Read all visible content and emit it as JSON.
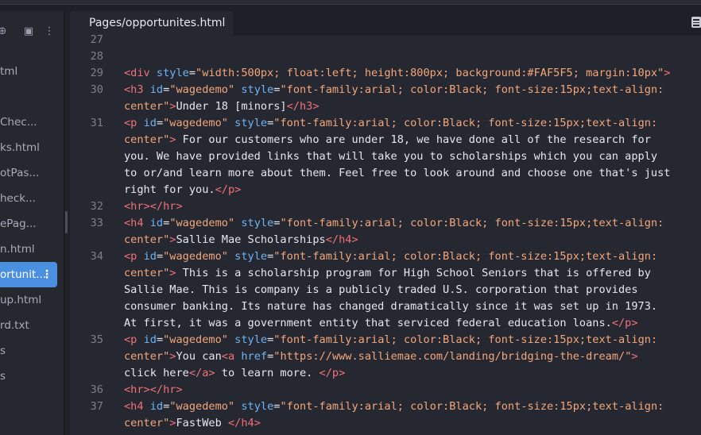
{
  "sidebar": {
    "icons": [
      "new-file-icon",
      "new-folder-icon",
      "more-icon"
    ],
    "files": [
      {
        "label": "tml",
        "active": false
      },
      {
        "label": "",
        "active": false
      },
      {
        "label": "Chec...",
        "active": false
      },
      {
        "label": "ks.html",
        "active": false
      },
      {
        "label": "otPas...",
        "active": false
      },
      {
        "label": "heck...",
        "active": false
      },
      {
        "label": "ePag...",
        "active": false
      },
      {
        "label": "n.html",
        "active": false
      },
      {
        "label": "ortunit...",
        "active": true
      },
      {
        "label": "up.html",
        "active": false
      },
      {
        "label": "rd.txt",
        "active": false
      },
      {
        "label": "s",
        "active": false
      },
      {
        "label": "s",
        "active": false
      }
    ]
  },
  "editor": {
    "tab_title": "Pages/opportunites.html",
    "lines": [
      {
        "n": "27",
        "segs": []
      },
      {
        "n": "28",
        "segs": []
      },
      {
        "n": "29",
        "segs": [
          [
            "tag",
            "<div "
          ],
          [
            "att",
            "style"
          ],
          [
            "plain",
            "="
          ],
          [
            "str",
            "\"width:500px; float:left; height:800px; background:#FAF5F5; margin:10px\""
          ],
          [
            "tag",
            ">"
          ]
        ]
      },
      {
        "n": "30",
        "segs": [
          [
            "tag",
            "<h3 "
          ],
          [
            "att",
            "id"
          ],
          [
            "plain",
            "="
          ],
          [
            "str",
            "\"wagedemo\""
          ],
          [
            "plain",
            " "
          ],
          [
            "att",
            "style"
          ],
          [
            "plain",
            "="
          ],
          [
            "str",
            "\"font-family:arial; color:Black; font-size:15px;text-align:"
          ]
        ]
      },
      {
        "n": "",
        "segs": [
          [
            "str",
            "center\""
          ],
          [
            "tag",
            ">"
          ],
          [
            "plain",
            "Under 18 [minors]"
          ],
          [
            "tag",
            "</h3>"
          ]
        ]
      },
      {
        "n": "31",
        "segs": [
          [
            "tag",
            "<p "
          ],
          [
            "att",
            "id"
          ],
          [
            "plain",
            "="
          ],
          [
            "str",
            "\"wagedemo\""
          ],
          [
            "plain",
            " "
          ],
          [
            "att",
            "style"
          ],
          [
            "plain",
            "="
          ],
          [
            "str",
            "\"font-family:arial; color:Black; font-size:15px;text-align:"
          ]
        ]
      },
      {
        "n": "",
        "segs": [
          [
            "str",
            "center\""
          ],
          [
            "tag",
            ">"
          ],
          [
            "plain",
            " For our customers who are under 18, we have done all of the research for"
          ]
        ]
      },
      {
        "n": "",
        "segs": [
          [
            "plain",
            "you. We have provided links that will take you to scholarships which you can apply"
          ]
        ]
      },
      {
        "n": "",
        "segs": [
          [
            "plain",
            "to or/and learn more about them. Feel free to look around and choose one that's just"
          ]
        ]
      },
      {
        "n": "",
        "segs": [
          [
            "plain",
            "right for you."
          ],
          [
            "tag",
            "</p>"
          ]
        ]
      },
      {
        "n": "32",
        "segs": [
          [
            "tag",
            "<hr></hr>"
          ]
        ]
      },
      {
        "n": "33",
        "segs": [
          [
            "tag",
            "<h4 "
          ],
          [
            "att",
            "id"
          ],
          [
            "plain",
            "="
          ],
          [
            "str",
            "\"wagedemo\""
          ],
          [
            "plain",
            " "
          ],
          [
            "att",
            "style"
          ],
          [
            "plain",
            "="
          ],
          [
            "str",
            "\"font-family:arial; color:Black; font-size:15px;text-align:"
          ]
        ]
      },
      {
        "n": "",
        "segs": [
          [
            "str",
            "center\""
          ],
          [
            "tag",
            ">"
          ],
          [
            "plain",
            "Sallie Mae Scholarships"
          ],
          [
            "tag",
            "</h4>"
          ]
        ]
      },
      {
        "n": "34",
        "segs": [
          [
            "tag",
            "<p "
          ],
          [
            "att",
            "id"
          ],
          [
            "plain",
            "="
          ],
          [
            "str",
            "\"wagedemo\""
          ],
          [
            "plain",
            " "
          ],
          [
            "att",
            "style"
          ],
          [
            "plain",
            "="
          ],
          [
            "str",
            "\"font-family:arial; color:Black; font-size:15px;text-align:"
          ]
        ]
      },
      {
        "n": "",
        "segs": [
          [
            "str",
            "center\""
          ],
          [
            "tag",
            ">"
          ],
          [
            "plain",
            " This is a scholarship program for High School Seniors that is offered by"
          ]
        ]
      },
      {
        "n": "",
        "segs": [
          [
            "plain",
            "Sallie Mae. This is company is a publicly traded U.S. corporation that provides"
          ]
        ]
      },
      {
        "n": "",
        "segs": [
          [
            "plain",
            "consumer banking. Its nature has changed dramatically since it was set up in 1973."
          ]
        ]
      },
      {
        "n": "",
        "segs": [
          [
            "plain",
            "At first, it was a government entity that serviced federal education loans."
          ],
          [
            "tag",
            "</p>"
          ]
        ]
      },
      {
        "n": "35",
        "segs": [
          [
            "tag",
            "<p "
          ],
          [
            "att",
            "id"
          ],
          [
            "plain",
            "="
          ],
          [
            "str",
            "\"wagedemo\""
          ],
          [
            "plain",
            " "
          ],
          [
            "att",
            "style"
          ],
          [
            "plain",
            "="
          ],
          [
            "str",
            "\"font-family:arial; color:Black; font-size:15px;text-align:"
          ]
        ]
      },
      {
        "n": "",
        "segs": [
          [
            "str",
            "center\""
          ],
          [
            "tag",
            ">"
          ],
          [
            "plain",
            "You can"
          ],
          [
            "tag",
            "<a "
          ],
          [
            "att",
            "href"
          ],
          [
            "plain",
            "="
          ],
          [
            "str",
            "\"https://www.salliemae.com/landing/bridging-the-dream/\""
          ],
          [
            "tag",
            ">"
          ]
        ]
      },
      {
        "n": "",
        "segs": [
          [
            "plain",
            "click here"
          ],
          [
            "tag",
            "</a>"
          ],
          [
            "plain",
            " to learn more. "
          ],
          [
            "tag",
            "</p>"
          ]
        ]
      },
      {
        "n": "36",
        "segs": [
          [
            "tag",
            "<hr></hr>"
          ]
        ]
      },
      {
        "n": "37",
        "segs": [
          [
            "tag",
            "<h4 "
          ],
          [
            "att",
            "id"
          ],
          [
            "plain",
            "="
          ],
          [
            "str",
            "\"wagedemo\""
          ],
          [
            "plain",
            " "
          ],
          [
            "att",
            "style"
          ],
          [
            "plain",
            "="
          ],
          [
            "str",
            "\"font-family:arial; color:Black; font-size:15px;text-align:"
          ]
        ]
      },
      {
        "n": "",
        "segs": [
          [
            "str",
            "center\""
          ],
          [
            "tag",
            ">"
          ],
          [
            "plain",
            "FastWeb "
          ],
          [
            "tag",
            "</h4>"
          ]
        ]
      }
    ]
  },
  "colors": {
    "active_file": "#4a8fe0",
    "tag": "#f07178",
    "attribute": "#6fb3f2",
    "string": "#f3a77b",
    "text": "#e6e8ee",
    "line_number": "#7b808c"
  }
}
